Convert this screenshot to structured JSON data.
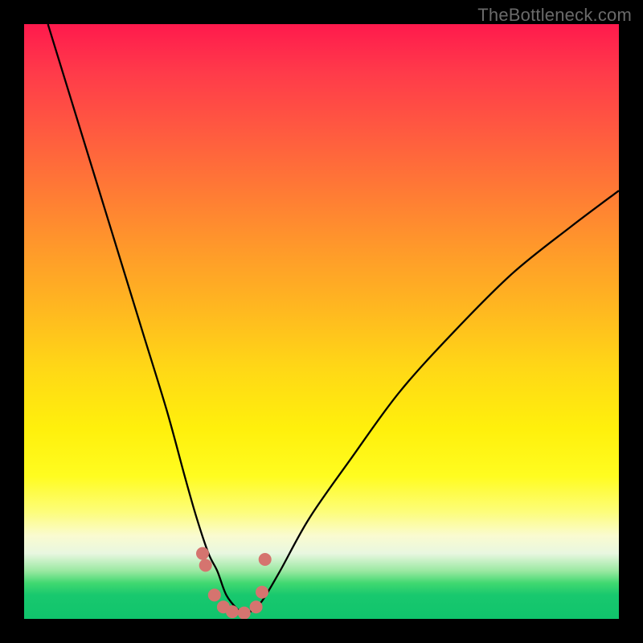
{
  "watermark": "TheBottleneck.com",
  "chart_data": {
    "type": "line",
    "title": "",
    "xlabel": "",
    "ylabel": "",
    "xlim": [
      0,
      100
    ],
    "ylim": [
      0,
      100
    ],
    "background_gradient": {
      "top_color": "#ff1a4d",
      "mid_color": "#fff00c",
      "bottom_color": "#10c46c"
    },
    "series": [
      {
        "name": "bottleneck-curve",
        "x": [
          4,
          8,
          12,
          16,
          20,
          24,
          27,
          29,
          31,
          32.5,
          34,
          36,
          37,
          38,
          40,
          43,
          48,
          55,
          63,
          72,
          82,
          92,
          100
        ],
        "values": [
          100,
          87,
          74,
          61,
          48,
          35,
          24,
          17,
          11,
          8,
          4,
          1.5,
          1,
          1.2,
          3,
          8,
          17,
          27,
          38,
          48,
          58,
          66,
          72
        ]
      }
    ],
    "markers": {
      "name": "trough-dots",
      "color": "#d5746f",
      "x": [
        30,
        30.5,
        32,
        33.5,
        35,
        37,
        39,
        40,
        40.5
      ],
      "values": [
        11,
        9,
        4,
        2,
        1.2,
        1,
        2,
        4.5,
        10
      ]
    }
  }
}
